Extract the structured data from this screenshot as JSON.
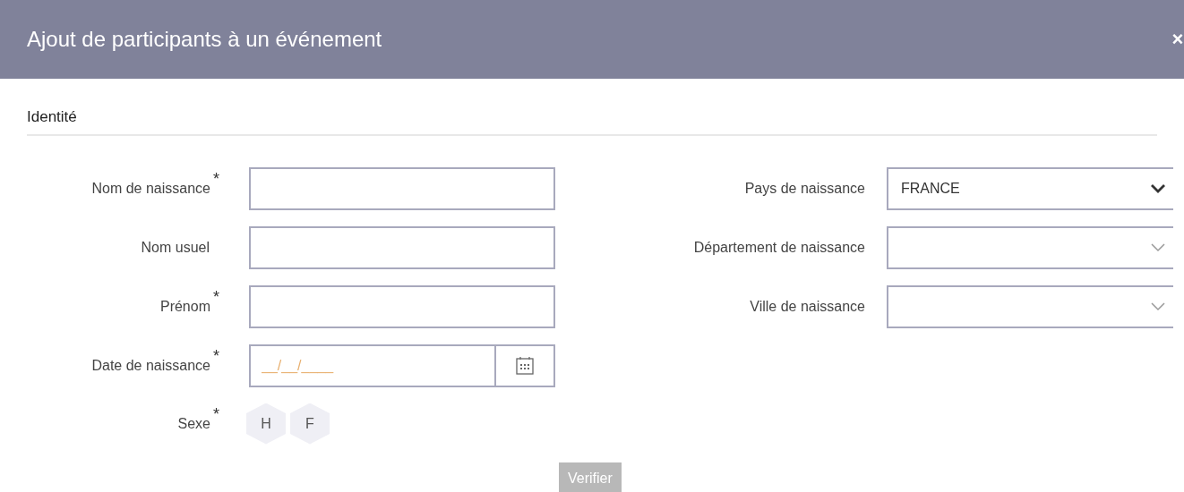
{
  "dialog": {
    "title": "Ajout de participants à un événement",
    "close": "×"
  },
  "section": {
    "title": "Identité"
  },
  "left_fields": [
    {
      "kind": "text",
      "label": "Nom de naissance",
      "required_mark": "*"
    },
    {
      "kind": "text",
      "label": "Nom usuel"
    },
    {
      "kind": "text",
      "label": "Prénom",
      "required_mark": "*"
    },
    {
      "kind": "date",
      "label": "Date de naissance",
      "required_mark": "*",
      "placeholder": "__/__/____"
    },
    {
      "kind": "sex",
      "label": "Sexe",
      "required_mark": "*",
      "options": [
        {
          "label": "H",
          "selected": false
        },
        {
          "label": "F",
          "selected": false
        }
      ]
    }
  ],
  "right_fields": [
    {
      "label": "Pays de naissance",
      "value": "FRANCE",
      "disabled": false
    },
    {
      "label": "Département de naissance",
      "disabled": true
    },
    {
      "label": "Ville de naissance",
      "disabled": true
    }
  ],
  "verify_button": {
    "label": "Verifier",
    "disabled": true
  }
}
